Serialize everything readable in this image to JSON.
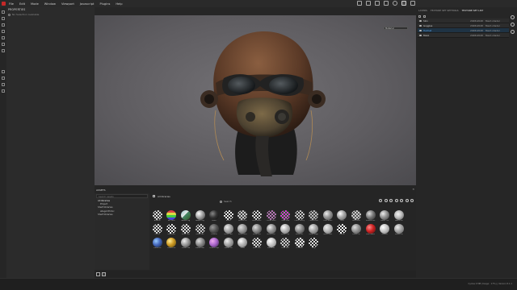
{
  "menu": [
    "File",
    "Edit",
    "Mode",
    "Window",
    "Viewport",
    "Javascript",
    "Plugins",
    "Help"
  ],
  "properties_panel": {
    "title": "PROPERTIES",
    "subtitle": "No Selection Available"
  },
  "viewport": {
    "display_select": "Material"
  },
  "right_panel": {
    "tabs": [
      "LAYERS",
      "TEXTURE SET SETTINGS",
      "TEXTURE SET LIST"
    ],
    "active_tab": 2,
    "texture_sets": [
      {
        "name": "Skin",
        "resolution": "2048x2048",
        "shader": "Mesh shader",
        "selected": false
      },
      {
        "name": "Goggles",
        "resolution": "2048x2048",
        "shader": "Mesh shader",
        "selected": false
      },
      {
        "name": "Helmet",
        "resolution": "2048x2048",
        "shader": "Mesh shader",
        "selected": true
      },
      {
        "name": "Mask",
        "resolution": "2048x2048",
        "shader": "Mesh shader",
        "selected": false
      }
    ]
  },
  "assets_panel": {
    "title": "ASSETS",
    "search_placeholder": "Search assets",
    "tree": [
      "All libraries",
      "Project",
      "Shelf libraries",
      "allegorithmic",
      "Shelf libraries"
    ],
    "header": "All libraries",
    "search_label": "Search",
    "items": [
      {
        "label": "Alkaline",
        "fill": "repeating-conic-gradient(#ddd 0 25%, #333 0 50%) 0 0/4px 4px"
      },
      {
        "label": "Alu Pana",
        "fill": "linear-gradient(#d44 0 25%, #dd4 25% 50%, #4c4 50% 75%, #44d 75%)"
      },
      {
        "label": "Adobe Log",
        "fill": "linear-gradient(135deg,#9cc 0,#e8e8e8 45%,#486 46%,#352 100%)"
      },
      {
        "label": "Adobe Log",
        "fill": "radial-gradient(circle at 35% 35%,#fff 0,#aaa 40%,#333 100%)"
      },
      {
        "label": "Black",
        "fill": "radial-gradient(circle at 35% 35%,#888 0,#333 45%,#0b0b0b 100%)"
      },
      {
        "label": "Brush",
        "fill": "repeating-conic-gradient(#eee 0 25%, #222 0 50%) 0 0/4px 4px"
      },
      {
        "label": "Bronze Pol",
        "fill": "repeating-conic-gradient(#ccc 0 25%, #444 0 50%) 0 0/4px 4px"
      },
      {
        "label": "Brick Black",
        "fill": "repeating-conic-gradient(#ddd 0 25%, #222 0 50%) 0 0/4px 4px"
      },
      {
        "label": "Cotton Blen",
        "fill": "repeating-conic-gradient(#b7b 0 25%, #333 0 50%) 0 0/4px 4px"
      },
      {
        "label": "Color Grid",
        "fill": "repeating-conic-gradient(#d3d 0 25%, #262 0 50%) 0 0/4px 4px"
      },
      {
        "label": "Chain Heavy",
        "fill": "repeating-conic-gradient(#ccc 0 25%, #333 0 50%) 0 0/4px 4px"
      },
      {
        "label": "Coated Met",
        "fill": "repeating-conic-gradient(#bbb 0 25%, #444 0 50%) 0 0/4px 4px"
      },
      {
        "label": "Dust Brass",
        "fill": "radial-gradient(circle at 35% 35%,#eee 0,#999 40%,#444 100%)"
      },
      {
        "label": "Dust",
        "fill": "radial-gradient(circle at 35% 35%,#fff 0,#aaa 40%,#555 100%)"
      },
      {
        "label": "Dust Multi",
        "fill": "repeating-conic-gradient(#ccc 0 25%, #555 0 50%) 0 0/4px 4px"
      },
      {
        "label": "Emboss Me",
        "fill": "radial-gradient(circle at 35% 35%,#ddd 0,#777 45%,#222 100%)"
      },
      {
        "label": "Fabric Cre",
        "fill": "radial-gradient(circle at 35% 35%,#eee 0,#999 40%,#333 100%)"
      },
      {
        "label": "Fabric Kni",
        "fill": "radial-gradient(circle at 40% 40%,#f4f4f4 0,#bbb 45%,#444 100%)"
      },
      {
        "label": "Glitter",
        "fill": "repeating-conic-gradient(#ddd 0 25%, #333 0 50%) 0 0/4px 4px"
      },
      {
        "label": "Hydraulic",
        "fill": "repeating-conic-gradient(#eee 0 25%, #222 0 50%) 0 0/4px 4px"
      },
      {
        "label": "Mesh Leat",
        "fill": "repeating-conic-gradient(#ddd 0 25%, #333 0 50%) 0 0/4px 4px"
      },
      {
        "label": "Metal Pan",
        "fill": "repeating-conic-gradient(#ccc 0 25%, #333 0 50%) 0 0/4px 4px"
      },
      {
        "label": "Leather",
        "fill": "radial-gradient(circle at 35% 35%,#999 0,#555 45%,#1e1e1e 100%)"
      },
      {
        "label": "Metal Pain",
        "fill": "radial-gradient(circle at 35% 35%,#eee 0,#aaa 40%,#555 100%)"
      },
      {
        "label": "Metal Rust",
        "fill": "radial-gradient(circle at 35% 35%,#ddd 0,#999 45%,#444 100%)"
      },
      {
        "label": "Metal Sca",
        "fill": "radial-gradient(circle at 35% 35%,#ddd 0,#888 45%,#333 100%)"
      },
      {
        "label": "Metal Dus",
        "fill": "radial-gradient(circle at 35% 35%,#eee 0,#999 40%,#444 100%)"
      },
      {
        "label": "Metal Cas",
        "fill": "radial-gradient(circle at 35% 35%,#fff 0,#bbb 40%,#666 100%)"
      },
      {
        "label": "Metal Scr",
        "fill": "radial-gradient(circle at 35% 35%,#ddd 0,#888 45%,#333 100%)"
      },
      {
        "label": "Metal Edge",
        "fill": "radial-gradient(circle at 35% 35%,#eee 0,#aaa 40%,#555 100%)"
      },
      {
        "label": "Metal Fiber",
        "fill": "radial-gradient(circle at 35% 35%,#eee 0,#bbb 40%,#666 100%)"
      },
      {
        "label": "Plastic",
        "fill": "repeating-conic-gradient(#fff 0 25%, #222 0 50%) 0 0/4px 4px"
      },
      {
        "label": "Plastic Sc",
        "fill": "radial-gradient(circle at 35% 35%,#ddd 0,#999 40%,#444 100%)"
      },
      {
        "label": "Red Plastic",
        "fill": "radial-gradient(circle at 35% 35%,#f88 0,#c22 45%,#501010 100%)"
      },
      {
        "label": "Rubber",
        "fill": "radial-gradient(circle at 35% 35%,#fff 0,#ccc 40%,#777 100%)"
      },
      {
        "label": "Rubber Bl",
        "fill": "radial-gradient(circle at 35% 35%,#eee 0,#aaa 40%,#555 100%)"
      },
      {
        "label": "Plastic Bl",
        "fill": "radial-gradient(circle at 35% 35%,#9cf 0,#46b 45%,#123 100%)"
      },
      {
        "label": "Plastic Dir",
        "fill": "radial-gradient(circle at 35% 35%,#fe9 0,#c92 45%,#541 100%)"
      },
      {
        "label": "Plastic Dia",
        "fill": "radial-gradient(circle at 35% 35%,#eee 0,#999 45%,#333 100%)"
      },
      {
        "label": "Plastic Fab",
        "fill": "radial-gradient(circle at 35% 35%,#ddd 0,#888 45%,#333 100%)"
      },
      {
        "label": "Plastic Grip",
        "fill": "radial-gradient(circle at 35% 35%,#eae 0,#a6c 45%,#324 100%)"
      },
      {
        "label": "Plastic Gri",
        "fill": "radial-gradient(circle at 35% 35%,#eee 0,#aaa 40%,#555 100%)"
      },
      {
        "label": "Silver",
        "fill": "radial-gradient(circle at 35% 35%,#fff 0,#bbb 40%,#666 100%)"
      },
      {
        "label": "Soft Cloth",
        "fill": "repeating-conic-gradient(#ddd 0 25%, #333 0 50%) 0 0/4px 4px"
      },
      {
        "label": "Stainless",
        "fill": "radial-gradient(circle at 35% 35%,#fff 0,#ccc 40%,#777 100%)"
      },
      {
        "label": "Steel Pain",
        "fill": "repeating-conic-gradient(#ccc 0 25%, #333 0 50%) 0 0/4px 4px"
      },
      {
        "label": "Tr Plastic",
        "fill": "repeating-conic-gradient(#eee 0 25%, #444 0 50%) 0 0/4px 4px"
      },
      {
        "label": "Vinyl",
        "fill": "repeating-conic-gradient(#ddd 0 25%, #222 0 50%) 0 0/4px 4px"
      }
    ]
  },
  "status": "Cycles 0 MB (Usage : 17%) | Version 8.1.1"
}
